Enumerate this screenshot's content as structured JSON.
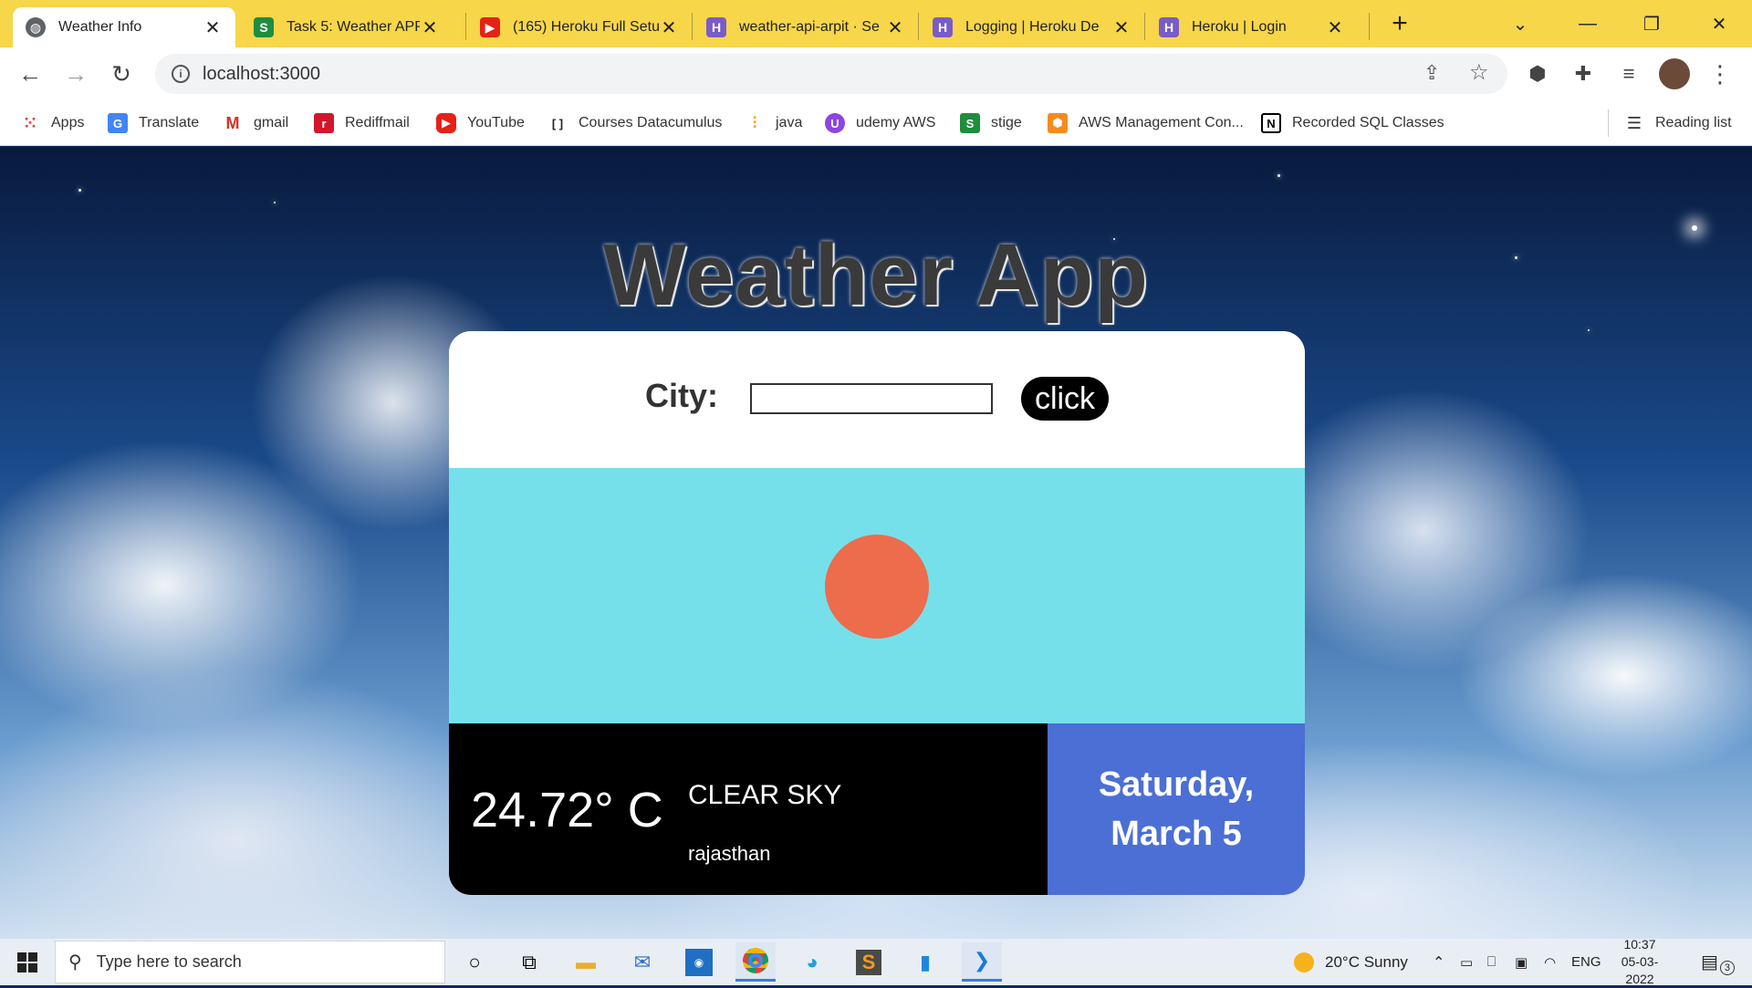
{
  "browser": {
    "tabs": [
      {
        "title": "Weather Info",
        "active": true,
        "icon": "globe-icon"
      },
      {
        "title": "Task 5: Weather APP (",
        "active": false,
        "icon": "s-icon"
      },
      {
        "title": "(165) Heroku Full Setu",
        "active": false,
        "icon": "youtube-icon"
      },
      {
        "title": "weather-api-arpit · Se",
        "active": false,
        "icon": "heroku-icon"
      },
      {
        "title": "Logging | Heroku De",
        "active": false,
        "icon": "heroku-icon"
      },
      {
        "title": "Heroku | Login",
        "active": false,
        "icon": "heroku-icon"
      }
    ],
    "url": "localhost:3000",
    "bookmarks": [
      {
        "label": "Apps",
        "icon": "apps-grid-icon"
      },
      {
        "label": "Translate",
        "icon": "translate-icon"
      },
      {
        "label": "gmail",
        "icon": "gmail-icon"
      },
      {
        "label": "Rediffmail",
        "icon": "rediff-icon"
      },
      {
        "label": "YouTube",
        "icon": "youtube-icon"
      },
      {
        "label": "Courses Datacumulus",
        "icon": "bracket-icon"
      },
      {
        "label": "java",
        "icon": "chart-icon"
      },
      {
        "label": "udemy AWS",
        "icon": "udemy-icon"
      },
      {
        "label": "stige",
        "icon": "s-icon"
      },
      {
        "label": "AWS Management Con...",
        "icon": "aws-icon"
      },
      {
        "label": "Recorded SQL Classes",
        "icon": "notion-icon"
      }
    ],
    "reading_list": "Reading list"
  },
  "app": {
    "title": "Weather App",
    "city_label": "City:",
    "city_value": "",
    "button_label": "click",
    "temperature": "24.72° C",
    "condition": "CLEAR SKY",
    "location": "rajasthan",
    "date_line1": "Saturday,",
    "date_line2": "March 5",
    "colors": {
      "sky_panel": "#76e0ea",
      "sun": "#ec6c4c",
      "date_panel": "#4b6fd4",
      "info_panel": "#000000"
    }
  },
  "taskbar": {
    "search_placeholder": "Type here to search",
    "weather": "20°C  Sunny",
    "language": "ENG",
    "time": "10:37",
    "date": "05-03-2022",
    "notifications": "3"
  }
}
